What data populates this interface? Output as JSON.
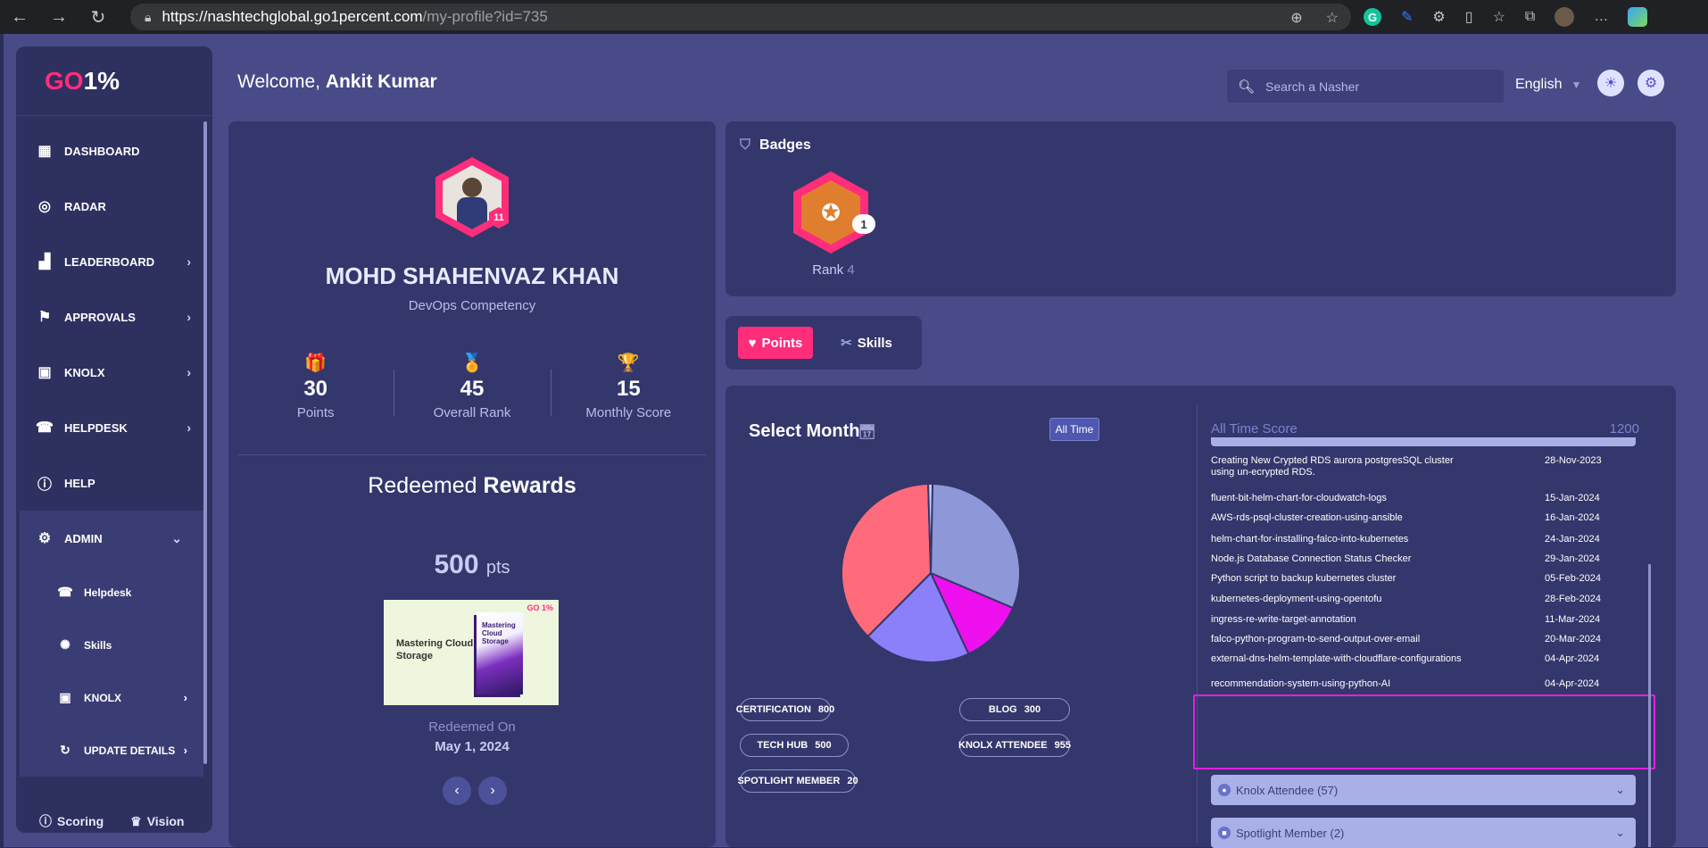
{
  "browser": {
    "url_host": "https://nashtechglobal.go1percent.com",
    "url_path": "/my-profile?id=735"
  },
  "sidebar": {
    "logo_go": "GO",
    "logo_pct": "1%",
    "items": [
      {
        "label": "DASHBOARD",
        "icon": "dashboard-icon",
        "chevron": false
      },
      {
        "label": "RADAR",
        "icon": "radar-icon",
        "chevron": false
      },
      {
        "label": "LEADERBOARD",
        "icon": "leaderboard-icon",
        "chevron": true
      },
      {
        "label": "APPROVALS",
        "icon": "approvals-icon",
        "chevron": true
      },
      {
        "label": "KNOLX",
        "icon": "knolx-icon",
        "chevron": true
      },
      {
        "label": "HELPDESK",
        "icon": "helpdesk-icon",
        "chevron": true
      },
      {
        "label": "HELP",
        "icon": "info-icon",
        "chevron": false
      },
      {
        "label": "ADMIN",
        "icon": "admin-gear-icon",
        "chevron": true
      }
    ],
    "admin_sub": [
      {
        "label": "Helpdesk",
        "icon": "helpdesk-icon"
      },
      {
        "label": "Skills",
        "icon": "skills-icon"
      },
      {
        "label": "KNOLX",
        "icon": "knolx-icon"
      },
      {
        "label": "UPDATE DETAILS",
        "icon": "refresh-icon"
      }
    ],
    "footer": {
      "scoring": "Scoring",
      "vision": "Vision"
    }
  },
  "header": {
    "welcome_prefix": "Welcome, ",
    "user_name": "Ankit Kumar",
    "search_placeholder": "Search a Nasher",
    "language": "English"
  },
  "profile": {
    "name": "MOHD SHAHENVAZ KHAN",
    "department": "DevOps Competency",
    "level": "11",
    "stats": [
      {
        "value": "30",
        "label": "Points",
        "icon": "gift-icon"
      },
      {
        "value": "45",
        "label": "Overall Rank",
        "icon": "podium-icon"
      },
      {
        "value": "15",
        "label": "Monthly Score",
        "icon": "trophy-icon"
      }
    ],
    "redeemed_title_a": "Redeemed ",
    "redeemed_title_b": "Rewards",
    "reward_points": "500",
    "reward_unit": "pts",
    "reward_image_text": "Mastering Cloud Storage",
    "reward_book_text": "Mastering Cloud Storage",
    "reward_logo": "GO 1%",
    "redeemed_on_label": "Redeemed On",
    "redeemed_date": "May 1, 2024"
  },
  "badges": {
    "title": "Badges",
    "count": "1",
    "rank_label": "Rank",
    "rank_value": "4"
  },
  "tabs": {
    "points": "Points",
    "skills": "Skills"
  },
  "points": {
    "select_month": "Select Month",
    "all_time_btn": "All Time",
    "score_label": "All Time Score",
    "score_value": "1200",
    "categories": [
      {
        "label": "CERTIFICATION",
        "value": "800"
      },
      {
        "label": "BLOG",
        "value": "300"
      },
      {
        "label": "TECH HUB",
        "value": "500"
      },
      {
        "label": "KNOLX ATTENDEE",
        "value": "955"
      },
      {
        "label": "SPOTLIGHT MEMBER",
        "value": "20"
      }
    ],
    "rows": [
      {
        "title": "Creating New Crypted RDS aurora postgresSQL cluster using un-ecrypted RDS.",
        "date": "28-Nov-2023"
      },
      {
        "title": "fluent-bit-helm-chart-for-cloudwatch-logs",
        "date": "15-Jan-2024"
      },
      {
        "title": "AWS-rds-psql-cluster-creation-using-ansible",
        "date": "16-Jan-2024"
      },
      {
        "title": "helm-chart-for-installing-falco-into-kubernetes",
        "date": "24-Jan-2024"
      },
      {
        "title": "Node.js Database Connection Status Checker",
        "date": "29-Jan-2024"
      },
      {
        "title": "Python script to backup kubernetes cluster",
        "date": "05-Feb-2024"
      },
      {
        "title": "kubernetes-deployment-using-opentofu",
        "date": "28-Feb-2024"
      },
      {
        "title": "ingress-re-write-target-annotation",
        "date": "11-Mar-2024"
      },
      {
        "title": "falco-python-program-to-send-output-over-email",
        "date": "20-Mar-2024"
      },
      {
        "title": "external-dns-helm-template-with-cloudflare-configurations",
        "date": "04-Apr-2024"
      },
      {
        "title": "recommendation-system-using-python-AI",
        "date": "04-Apr-2024"
      }
    ],
    "accordions": [
      "Knolx Attendee (57)",
      "Spotlight Member (2)"
    ]
  },
  "chart_data": {
    "type": "pie",
    "categories": [
      "Certification",
      "Blog",
      "Tech Hub",
      "Knolx Attendee",
      "Spotlight Member"
    ],
    "values": [
      800,
      300,
      500,
      955,
      20
    ],
    "colors": [
      "#8e97d8",
      "#ee10ee",
      "#8b80f9",
      "#ff6b7a",
      "#ccd0ff"
    ]
  }
}
